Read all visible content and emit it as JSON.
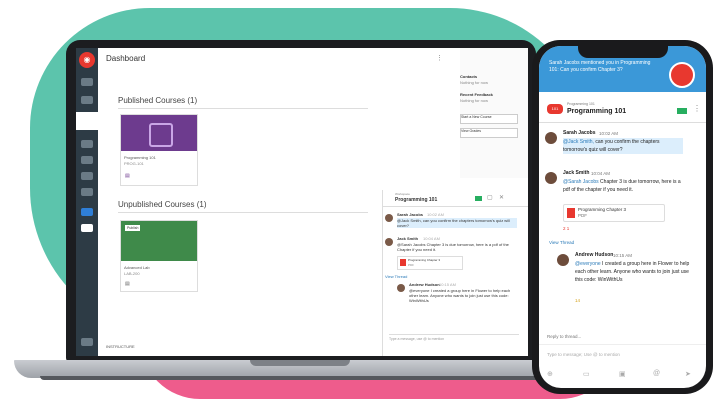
{
  "laptop": {
    "header_title": "Dashboard",
    "published_title": "Published Courses (1)",
    "unpublished_title": "Unpublished Courses (1)",
    "published_card": {
      "name": "Programming 101",
      "sub": "PROG-101"
    },
    "unpublished_card": {
      "badge": "Publish",
      "name": "Advanced Lab",
      "sub": "LAB-200"
    },
    "right_panel": {
      "contacts": "Contacts",
      "contact_sub": "Nothing for now",
      "recent": "Recent Feedback",
      "recent_sub": "Nothing for now",
      "btn1": "Start a New Course",
      "btn2": "View Grades"
    },
    "footer": "INSTRUCTURE",
    "chat": {
      "course_label": "Workspace",
      "course": "Programming 101",
      "msg1_author": "Sarah Jacobs",
      "msg1_time": "10:02 AM",
      "msg1_text": "@Jack Smith, can you confirm the chapters tomorrow's quiz will cover?",
      "msg2_author": "Jack Smith",
      "msg2_time": "10:04 AM",
      "msg2_text": "@Sarah Jacobs Chapter 3 is due tomorrow, here is a pdf of the Chapter if you need it.",
      "file_name": "Programming Chapter 3",
      "file_type": "PDF",
      "view_thread": "View Thread",
      "msg3_author": "Andrew Hudson",
      "msg3_time": "10:15 AM",
      "msg3_text": "@everyone I created a group here in Flower to help each other learn. Anyone who wants to join just use this code: WinWithUs",
      "input_placeholder": "Type a message, use @ to mention"
    }
  },
  "phone": {
    "banner_text": "Sarah Jacobs mentioned you in Programming 101: Can you confirm Chapter 3?",
    "course_label": "Programming 101",
    "course": "Programming 101",
    "back_badge": "101",
    "msg1_author": "Sarah Jacobs",
    "msg1_time": "10:02 AM",
    "msg1_mention": "@Jack Smith,",
    "msg1_text": "can you confirm the chapters tomorrow's quiz will cover?",
    "msg2_author": "Jack Smith",
    "msg2_time": "10:04 AM",
    "msg2_mention": "@Sarah Jacobs",
    "msg2_text": "Chapter 3 is due tomorrow, here is a pdf of the chapter if you need it.",
    "file_name": "Programming Chapter 3",
    "file_type": "PDF",
    "reactions": "2  1",
    "view_thread": "View Thread",
    "msg3_author": "Andrew Hudson",
    "msg3_time": "10:15 AM",
    "msg3_mention": "@everyone",
    "msg3_text": "I created a group here in Flower to help each other learn. Anyone who wants to join just use this code: WinWithUs",
    "msg3_reaction": "14",
    "input_placeholder": "Type to message; Use @ to mention",
    "reply_label": "Reply to thread..."
  },
  "colors": {
    "teal": "#5cc4ac",
    "pink": "#ee5c8c",
    "canvas_red": "#e8382f",
    "nav": "#2d3b45",
    "accent_blue": "#3b98d8",
    "green": "#27ae60",
    "purple": "#6d3b8e"
  }
}
